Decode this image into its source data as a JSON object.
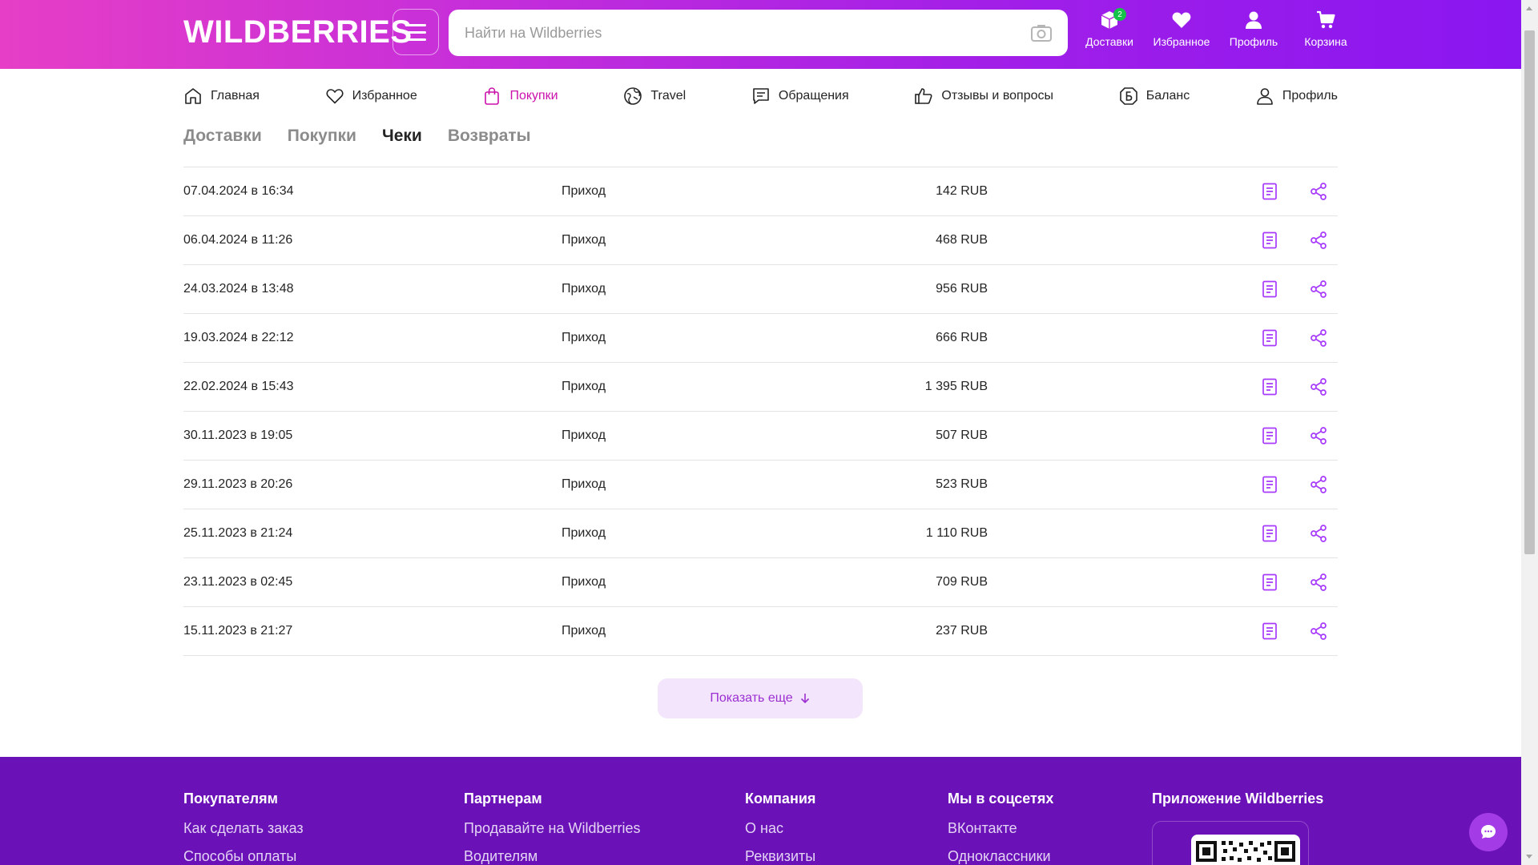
{
  "header": {
    "logo": "WILDBERRIES",
    "search_placeholder": "Найти на Wildberries",
    "icons": [
      {
        "name": "deliveries-icon",
        "label": "Доставки",
        "badge": "2"
      },
      {
        "name": "favorites-icon",
        "label": "Избранное"
      },
      {
        "name": "profile-icon",
        "label": "Профиль"
      },
      {
        "name": "cart-icon",
        "label": "Корзина"
      }
    ]
  },
  "nav": {
    "items": [
      {
        "label": "Главная",
        "icon": "home-icon"
      },
      {
        "label": "Избранное",
        "icon": "heart-icon"
      },
      {
        "label": "Покупки",
        "icon": "bag-icon",
        "active": true
      },
      {
        "label": "Travel",
        "icon": "travel-icon"
      },
      {
        "label": "Обращения",
        "icon": "chat-icon"
      },
      {
        "label": "Отзывы и вопросы",
        "icon": "thumbs-up-icon"
      },
      {
        "label": "Баланс",
        "icon": "balance-icon"
      },
      {
        "label": "Профиль",
        "icon": "user-icon"
      }
    ]
  },
  "tabs": [
    {
      "label": "Доставки"
    },
    {
      "label": "Покупки"
    },
    {
      "label": "Чеки",
      "active": true
    },
    {
      "label": "Возвраты"
    }
  ],
  "receipts": [
    {
      "date": "07.04.2024 в 16:34",
      "type": "Приход",
      "sum": "142 RUB"
    },
    {
      "date": "06.04.2024 в 11:26",
      "type": "Приход",
      "sum": "468 RUB"
    },
    {
      "date": "24.03.2024 в 13:48",
      "type": "Приход",
      "sum": "956 RUB"
    },
    {
      "date": "19.03.2024 в 22:12",
      "type": "Приход",
      "sum": "666 RUB"
    },
    {
      "date": "22.02.2024 в 15:43",
      "type": "Приход",
      "sum": "1 395 RUB"
    },
    {
      "date": "30.11.2023 в 19:05",
      "type": "Приход",
      "sum": "507 RUB"
    },
    {
      "date": "29.11.2023 в 20:26",
      "type": "Приход",
      "sum": "523 RUB"
    },
    {
      "date": "25.11.2023 в 21:24",
      "type": "Приход",
      "sum": "1 110 RUB"
    },
    {
      "date": "23.11.2023 в 02:45",
      "type": "Приход",
      "sum": "709 RUB"
    },
    {
      "date": "15.11.2023 в 21:27",
      "type": "Приход",
      "sum": "237 RUB"
    }
  ],
  "show_more": "Показать еще",
  "footer": {
    "columns": [
      {
        "title": "Покупателям",
        "links": [
          "Как сделать заказ",
          "Способы оплаты"
        ]
      },
      {
        "title": "Партнерам",
        "links": [
          "Продавайте на Wildberries",
          "Водителям"
        ]
      },
      {
        "title": "Компания",
        "links": [
          "О нас",
          "Реквизиты"
        ]
      },
      {
        "title": "Мы в соцсетях",
        "links": [
          "ВКонтакте",
          "Одноклассники"
        ]
      },
      {
        "title": "Приложение Wildberries",
        "links": []
      }
    ]
  },
  "colors": {
    "accent": "#cb11ab",
    "footer_bg": "#6a11b8",
    "icon_purple": "#a73afd"
  }
}
